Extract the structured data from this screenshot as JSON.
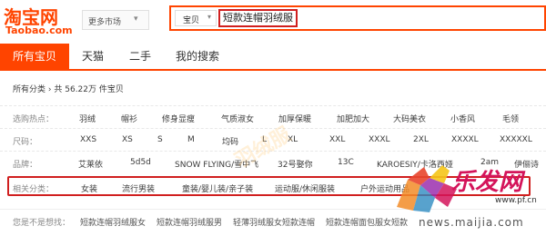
{
  "header": {
    "logo_main": "淘宝网",
    "logo_sub": "Taobao.com",
    "market_label": "更多市场",
    "search": {
      "category": "宝贝",
      "query": "短款连帽羽绒服"
    }
  },
  "tabs": [
    {
      "label": "所有宝贝",
      "active": true
    },
    {
      "label": "天猫",
      "active": false
    },
    {
      "label": "二手",
      "active": false
    },
    {
      "label": "我的搜索",
      "active": false
    }
  ],
  "breadcrumb": {
    "root": "所有分类",
    "sep": "›",
    "count_text": "共 56.22万 件宝贝"
  },
  "filters": {
    "hot": {
      "label": "选购热点：",
      "items": [
        "羽绒",
        "帽衫",
        "修身显瘦",
        "气质淑女",
        "加厚保暖",
        "加肥加大",
        "大码美衣",
        "小香风",
        "毛领"
      ]
    },
    "size": {
      "label": "尺码：",
      "items": [
        "XXS",
        "XS",
        "S",
        "M",
        "均码",
        "L",
        "XL",
        "XXL",
        "XXXL",
        "2XL",
        "XXXXL",
        "XXXXXL"
      ]
    },
    "brand": {
      "label": "品牌：",
      "items": [
        "艾莱依",
        "5d5d",
        "SNOW FLYING/雪中飞",
        "32号娶你",
        "13C",
        "KAROESIY/卡洛西娅",
        "2am",
        "伊俪诗"
      ]
    },
    "related": {
      "label": "相关分类：",
      "items": [
        "女装",
        "流行男装",
        "童装/婴儿装/亲子装",
        "运动服/休闲服装",
        "户外运动用品"
      ]
    },
    "suggest": {
      "label": "您是不是想找：",
      "items": [
        "短款连帽羽绒服女",
        "短款连帽羽绒服男",
        "轻薄羽绒服女短款连帽",
        "短款连帽面包服女短款"
      ]
    }
  },
  "watermark": {
    "faint": "羽绒服",
    "brand": "乐发网",
    "url_small": "www.pf.cn",
    "url_main": "news.maijia.com"
  },
  "colors": {
    "accent": "#ff4400",
    "highlight_box": "#d01f1f"
  }
}
